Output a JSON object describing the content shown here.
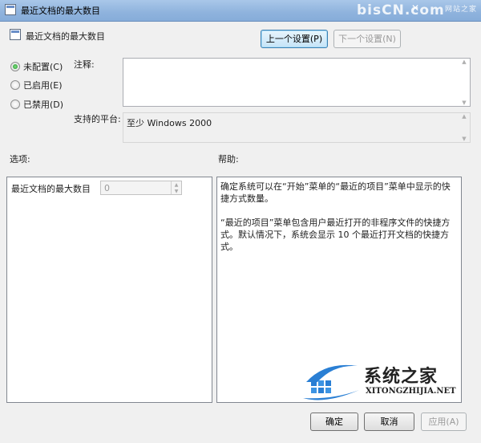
{
  "window": {
    "title": "最近文档的最大数目",
    "watermark": "bisCN.com",
    "watermark_small": "网站之家"
  },
  "header": {
    "title": "最近文档的最大数目",
    "prev_button": "上一个设置(P)",
    "next_button": "下一个设置(N)"
  },
  "state": {
    "options": [
      {
        "label": "未配置(C)",
        "checked": true
      },
      {
        "label": "已启用(E)",
        "checked": false
      },
      {
        "label": "已禁用(D)",
        "checked": false
      }
    ]
  },
  "comment": {
    "label": "注释:",
    "value": ""
  },
  "platform": {
    "label": "支持的平台:",
    "value": "至少 Windows 2000"
  },
  "options_section": {
    "label": "选项:",
    "setting_label": "最近文档的最大数目",
    "setting_value": "0"
  },
  "help_section": {
    "label": "帮助:",
    "paragraph1": "确定系统可以在“开始”菜单的“最近的项目”菜单中显示的快捷方式数量。",
    "paragraph2": "“最近的项目”菜单包含用户最近打开的非程序文件的快捷方式。默认情况下，系统会显示 10 个最近打开文档的快捷方式。"
  },
  "branding": {
    "name": "系统之家",
    "url": "XITONGZHIJIA.NET"
  },
  "footer": {
    "ok": "确定",
    "cancel": "取消",
    "apply": "应用(A)"
  }
}
